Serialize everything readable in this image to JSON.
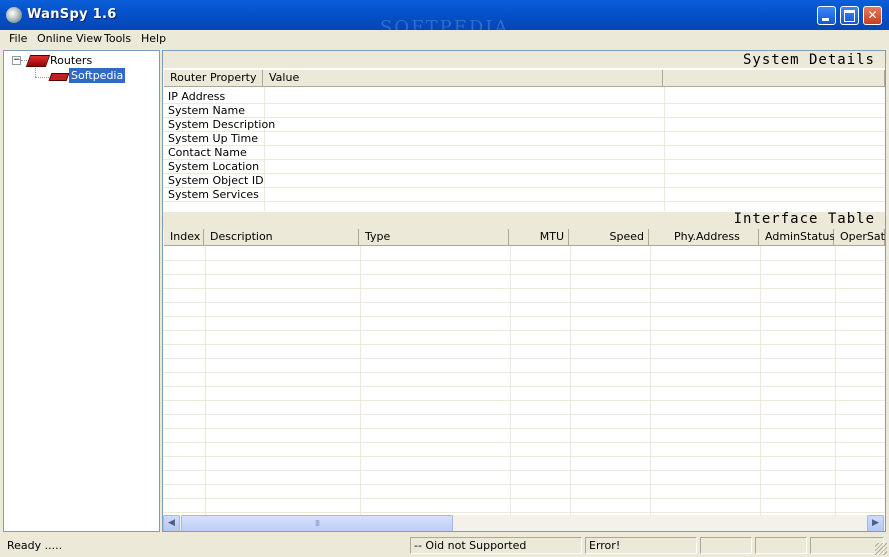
{
  "window": {
    "title": "WanSpy 1.6",
    "watermark": "SOFTPEDIA"
  },
  "menu": [
    "File",
    "Online View",
    "Tools",
    "Help"
  ],
  "tree": {
    "root": "Routers",
    "child": "Softpedia"
  },
  "system_details": {
    "title": "System Details",
    "columns": [
      "Router Property",
      "Value"
    ],
    "properties": [
      "IP Address",
      "System Name",
      "System Description",
      "System Up Time",
      "Contact Name",
      "System Location",
      "System Object ID",
      "System Services"
    ]
  },
  "interface_table": {
    "title": "Interface Table",
    "columns": [
      "Index",
      "Description",
      "Type",
      "MTU",
      "Speed",
      "Phy.Address",
      "AdminStatus",
      "OperSat"
    ]
  },
  "scrollbar": {
    "thumb_grip": "III",
    "left_arrow": "◀",
    "right_arrow": "▶"
  },
  "status": {
    "ready": "Ready .....",
    "oid": "-- Oid not Supported",
    "error": "Error!"
  }
}
